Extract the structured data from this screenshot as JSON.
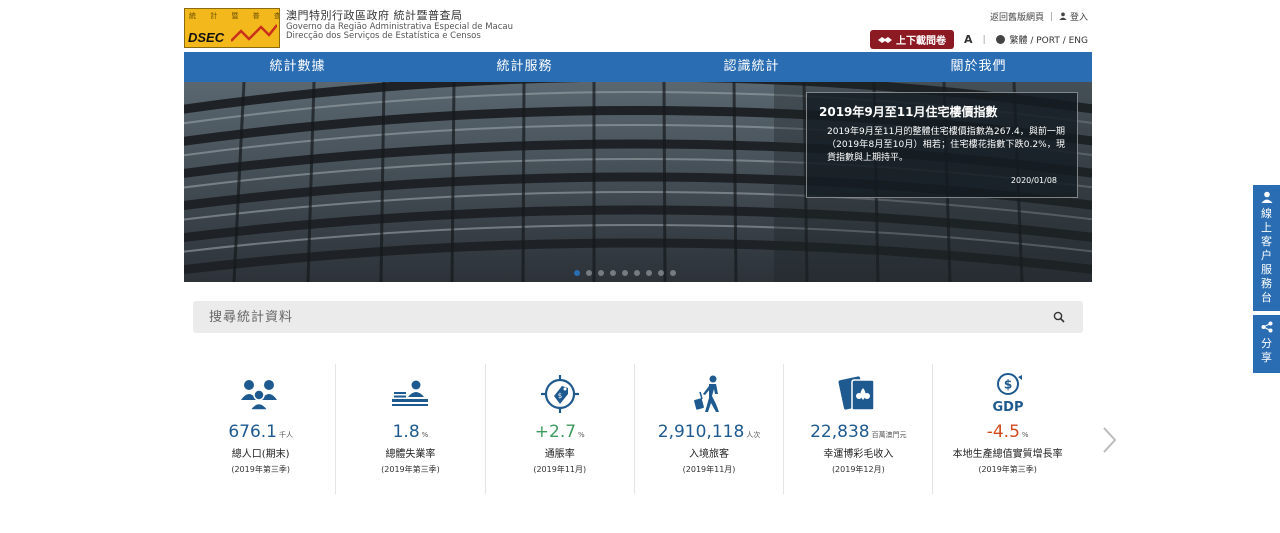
{
  "org": {
    "logo_text": "DSEC",
    "logo_marks": "統 計 暨 普 查 局",
    "name_zh": "澳門特別行政區政府 統計暨普查局",
    "name_pt1": "Governo da Região Administrativa Especial de Macau",
    "name_pt2": "Direcção dos Serviços de Estatística e Censos"
  },
  "top_links": {
    "home_old": "返回舊版網頁",
    "login": "登入",
    "download": "上下載問卷",
    "font_size": "A",
    "languages": "繁體 / PORT / ENG"
  },
  "nav": [
    "統計數據",
    "統計服務",
    "認識統計",
    "關於我們"
  ],
  "banner": {
    "title": "2019年9月至11月住宅樓價指數",
    "body": "2019年9月至11月的整體住宅樓價指數為267.4，與前一期（2019年8月至10月）相若；住宅樓花指數下跌0.2%，現貨指數與上期持平。",
    "date": "2020/01/08",
    "slide_count": 9,
    "active_slide": 1
  },
  "search": {
    "placeholder": "搜尋統計資料"
  },
  "stats": [
    {
      "icon": "people-icon",
      "value": "676.1",
      "unit": "千人",
      "label": "總人口(期末)",
      "period": "(2019年第三季)",
      "color": "#1e5a8f"
    },
    {
      "icon": "office-desk-icon",
      "value": "1.8",
      "unit": "%",
      "label": "總體失業率",
      "period": "(2019年第三季)",
      "color": "#1e5a8f"
    },
    {
      "icon": "price-tag-icon",
      "value": "+2.7",
      "unit": "%",
      "label": "通脹率",
      "period": "(2019年11月)",
      "color": "#3e9b5e"
    },
    {
      "icon": "traveller-icon",
      "value": "2,910,118",
      "unit": "人次",
      "label": "入境旅客",
      "period": "(2019年11月)",
      "color": "#1e5a8f"
    },
    {
      "icon": "gaming-cards-icon",
      "value": "22,838",
      "unit": "百萬澳門元",
      "label": "幸運博彩毛收入",
      "period": "(2019年12月)",
      "color": "#1e5a8f"
    },
    {
      "icon": "gdp-icon",
      "value": "-4.5",
      "unit": "%",
      "label": "本地生產總值實質增長率",
      "period": "(2019年第三季)",
      "color": "#d04a1c"
    }
  ],
  "gdp_icon_text": "GDP",
  "side_tabs": {
    "service": "線上客户服務台",
    "share": "分享"
  },
  "colors": {
    "nav_blue": "#2a6db3",
    "download_red": "#8b1a22",
    "value_blue": "#1e5a8f",
    "value_green": "#3e9b5e",
    "value_red": "#d04a1c"
  }
}
